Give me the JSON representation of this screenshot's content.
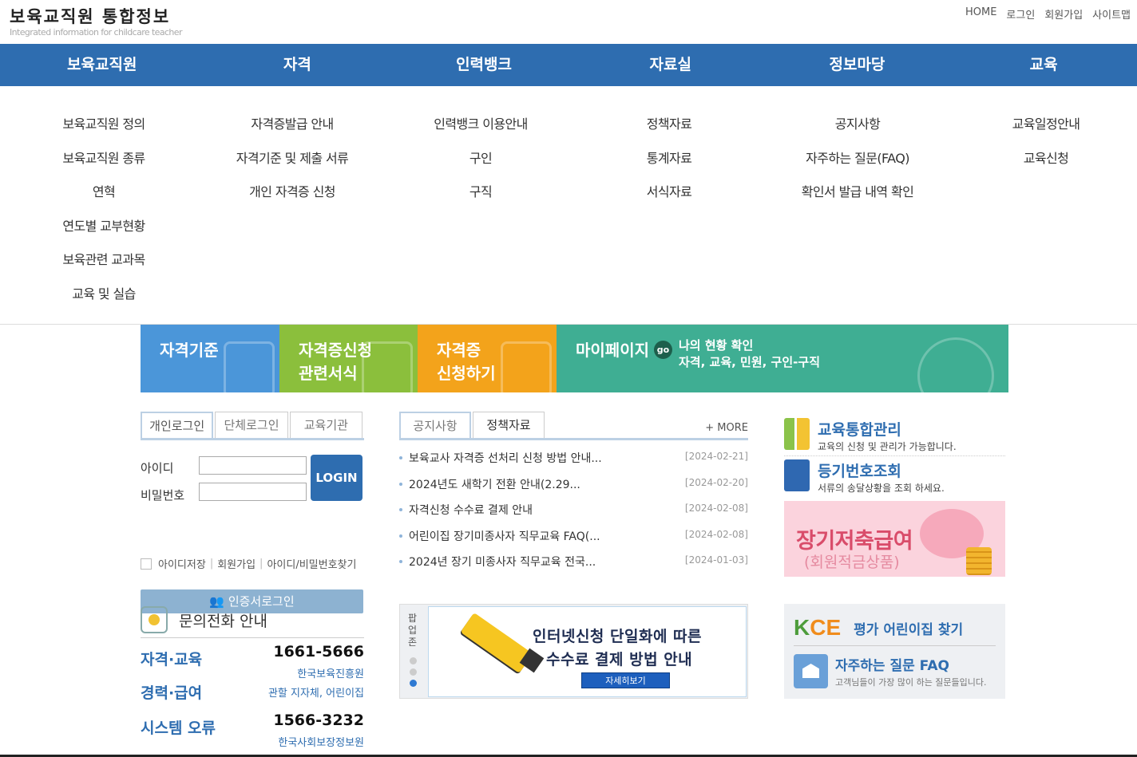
{
  "header": {
    "logo_title": "보육교직원 통합정보",
    "logo_sub": "Integrated information for childcare teacher",
    "util": [
      "HOME",
      "로그인",
      "회원가입",
      "사이트맵"
    ]
  },
  "gnb": [
    "보육교직원",
    "자격",
    "인력뱅크",
    "자료실",
    "정보마당",
    "교육"
  ],
  "submenu": [
    [
      "보육교직원 정의",
      "보육교직원 종류",
      "연혁",
      "연도별 교부현황",
      "보육관련 교과목",
      "교육 및 실습"
    ],
    [
      "자격증발급 안내",
      "자격기준 및 제출 서류",
      "개인 자격증 신청"
    ],
    [
      "인력뱅크 이용안내",
      "구인",
      "구직"
    ],
    [
      "정책자료",
      "통계자료",
      "서식자료"
    ],
    [
      "공지사항",
      "자주하는 질문(FAQ)",
      "확인서 발급 내역 확인"
    ],
    [
      "교육일정안내",
      "교육신청"
    ]
  ],
  "banner": {
    "b1": "자격기준",
    "b2_line1": "자격증신청",
    "b2_line2": "관련서식",
    "b3_line1": "자격증",
    "b3_line2": "신청하기",
    "b4_title": "마이페이지",
    "b4_go": "go",
    "b4_line1": "나의 현황 확인",
    "b4_line2": "자격, 교육, 민원, 구인-구직"
  },
  "login": {
    "tabs": [
      "개인로그인",
      "단체로그인",
      "교육기관"
    ],
    "id_label": "아이디",
    "pw_label": "비밀번호",
    "login_button": "LOGIN",
    "save_id": "아이디저장",
    "join": "회원가입",
    "find": "아이디/비밀번호찾기",
    "cert_button": "인증서로그인"
  },
  "contact": {
    "title": "문의전화 안내",
    "rows": [
      {
        "label": "자격·교육",
        "number": "1661-5666",
        "org": "한국보육진흥원"
      },
      {
        "label": "경력·급여",
        "number": "",
        "org": "관할 지자체, 어린이집"
      },
      {
        "label": "시스템 오류",
        "number": "1566-3232",
        "org": "한국사회보장정보원"
      }
    ]
  },
  "notice": {
    "tabs": [
      "공지사항",
      "정책자료"
    ],
    "more": "+ MORE",
    "items": [
      {
        "title": "보육교사 자격증 선처리 신청 방법 안내...",
        "date": "[2024-02-21]"
      },
      {
        "title": "2024년도 새학기 전환 안내(2.29...",
        "date": "[2024-02-20]"
      },
      {
        "title": "자격신청 수수료 결제 안내",
        "date": "[2024-02-08]"
      },
      {
        "title": "어린이집 장기미종사자 직무교육 FAQ(...",
        "date": "[2024-02-08]"
      },
      {
        "title": "2024년 장기 미종사자 직무교육 전국...",
        "date": "[2024-01-03]"
      }
    ]
  },
  "popup": {
    "label": "팝업존",
    "line1": "인터넷신청 단일화에 따른",
    "line2": "수수료 결제 방법 안내",
    "cta": "자세히보기"
  },
  "right": {
    "edu_title": "교육통합관리",
    "edu_desc": "교육의 신청 및 관리가 가능합니다.",
    "reg_title": "등기번호조회",
    "reg_desc": "서류의 송달상황을 조회 하세요.",
    "savings_title": "장기저축급여",
    "savings_sub": "(회원적금상품)",
    "kce_logo_k": "K",
    "kce_logo_rest": "CE",
    "kce_text": "평가 어린이집 찾기",
    "faq_title": "자주하는 질문 FAQ",
    "faq_desc": "고객님들이 가장 많이 하는 질문들입니다."
  }
}
